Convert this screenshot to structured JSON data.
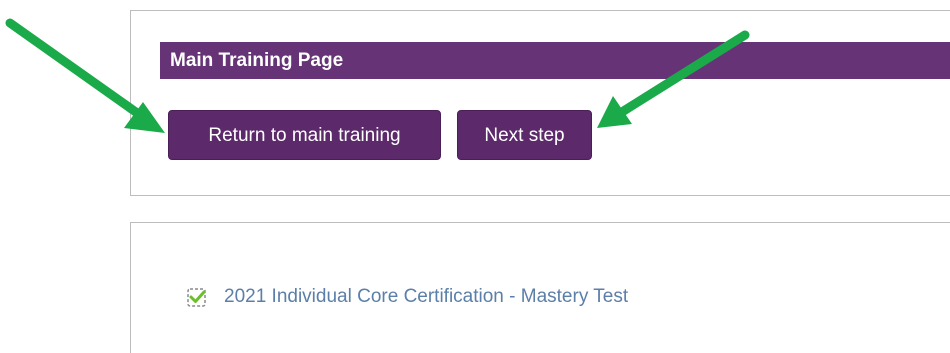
{
  "header": {
    "title": "Main Training Page"
  },
  "actions": {
    "return_label": "Return to main training",
    "next_label": "Next step"
  },
  "tasks": [
    {
      "label": "2021 Individual Core Certification - Mastery Test",
      "status_icon": "checkbox-checked-icon",
      "completed": true
    }
  ],
  "colors": {
    "header_bg": "#663377",
    "button_bg": "#5c2a6a",
    "link": "#5b7fa8",
    "check": "#6abf2a",
    "annotation_arrow": "#1aaa4a"
  }
}
